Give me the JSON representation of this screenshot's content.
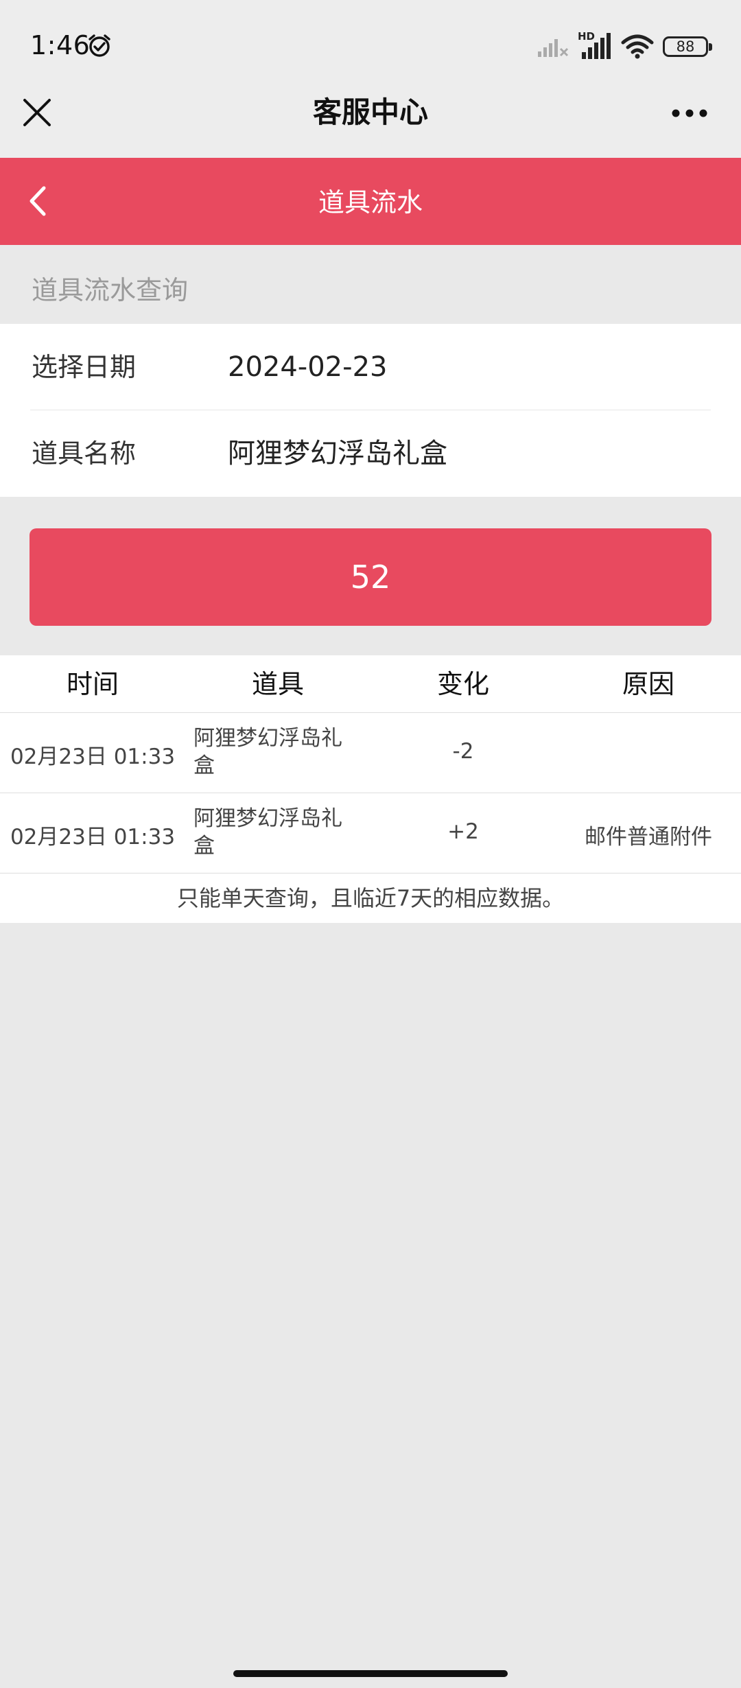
{
  "status_bar": {
    "time": "1:46",
    "network_label": "HD",
    "battery": "88"
  },
  "header": {
    "title": "客服中心"
  },
  "nav": {
    "title": "道具流水"
  },
  "query": {
    "section_title": "道具流水查询",
    "date_label": "选择日期",
    "date_value": "2024-02-23",
    "item_label": "道具名称",
    "item_value": "阿狸梦幻浮岛礼盒"
  },
  "button": {
    "label": "52"
  },
  "table": {
    "headers": [
      "时间",
      "道具",
      "变化",
      "原因"
    ],
    "rows": [
      {
        "time": "02月23日 01:33",
        "item_line1": "阿狸梦幻浮岛礼",
        "item_line2": "盒",
        "change": "-2",
        "reason": ""
      },
      {
        "time": "02月23日 01:33",
        "item_line1": "阿狸梦幻浮岛礼",
        "item_line2": "盒",
        "change": "+2",
        "reason": "邮件普通附件"
      }
    ],
    "note": "只能单天查询，且临近7天的相应数据。"
  },
  "colors": {
    "accent": "#e84a5f",
    "background": "#e9e9e9",
    "header_bg": "#ededed"
  },
  "icons": [
    "alarm-clock-icon",
    "signal-weak-icon",
    "signal-strong-icon",
    "wifi-icon",
    "battery-icon",
    "close-icon",
    "more-icon",
    "back-chevron-icon"
  ]
}
